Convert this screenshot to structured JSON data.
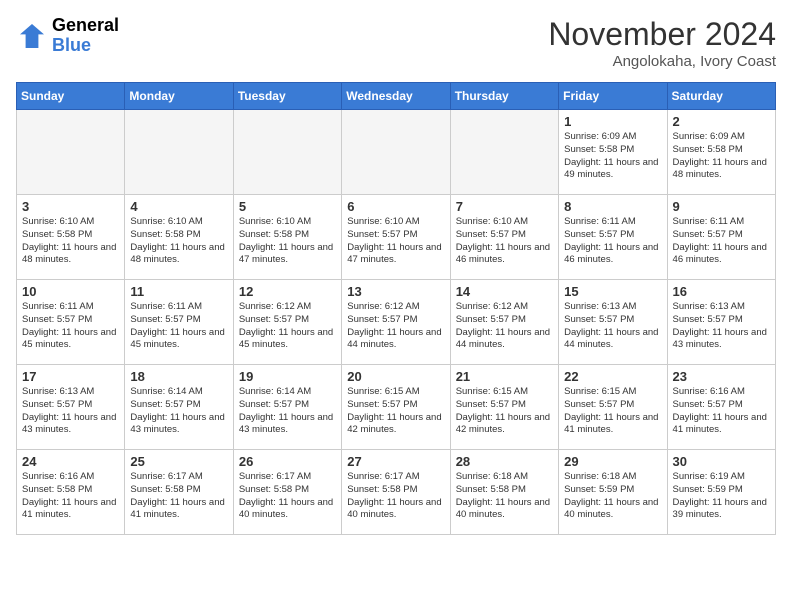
{
  "header": {
    "logo": {
      "general": "General",
      "blue": "Blue"
    },
    "month": "November 2024",
    "location": "Angolokaha, Ivory Coast"
  },
  "weekdays": [
    "Sunday",
    "Monday",
    "Tuesday",
    "Wednesday",
    "Thursday",
    "Friday",
    "Saturday"
  ],
  "weeks": [
    [
      {
        "day": "",
        "empty": true
      },
      {
        "day": "",
        "empty": true
      },
      {
        "day": "",
        "empty": true
      },
      {
        "day": "",
        "empty": true
      },
      {
        "day": "",
        "empty": true
      },
      {
        "day": "1",
        "sunrise": "Sunrise: 6:09 AM",
        "sunset": "Sunset: 5:58 PM",
        "daylight": "Daylight: 11 hours and 49 minutes."
      },
      {
        "day": "2",
        "sunrise": "Sunrise: 6:09 AM",
        "sunset": "Sunset: 5:58 PM",
        "daylight": "Daylight: 11 hours and 48 minutes."
      }
    ],
    [
      {
        "day": "3",
        "sunrise": "Sunrise: 6:10 AM",
        "sunset": "Sunset: 5:58 PM",
        "daylight": "Daylight: 11 hours and 48 minutes."
      },
      {
        "day": "4",
        "sunrise": "Sunrise: 6:10 AM",
        "sunset": "Sunset: 5:58 PM",
        "daylight": "Daylight: 11 hours and 48 minutes."
      },
      {
        "day": "5",
        "sunrise": "Sunrise: 6:10 AM",
        "sunset": "Sunset: 5:58 PM",
        "daylight": "Daylight: 11 hours and 47 minutes."
      },
      {
        "day": "6",
        "sunrise": "Sunrise: 6:10 AM",
        "sunset": "Sunset: 5:57 PM",
        "daylight": "Daylight: 11 hours and 47 minutes."
      },
      {
        "day": "7",
        "sunrise": "Sunrise: 6:10 AM",
        "sunset": "Sunset: 5:57 PM",
        "daylight": "Daylight: 11 hours and 46 minutes."
      },
      {
        "day": "8",
        "sunrise": "Sunrise: 6:11 AM",
        "sunset": "Sunset: 5:57 PM",
        "daylight": "Daylight: 11 hours and 46 minutes."
      },
      {
        "day": "9",
        "sunrise": "Sunrise: 6:11 AM",
        "sunset": "Sunset: 5:57 PM",
        "daylight": "Daylight: 11 hours and 46 minutes."
      }
    ],
    [
      {
        "day": "10",
        "sunrise": "Sunrise: 6:11 AM",
        "sunset": "Sunset: 5:57 PM",
        "daylight": "Daylight: 11 hours and 45 minutes."
      },
      {
        "day": "11",
        "sunrise": "Sunrise: 6:11 AM",
        "sunset": "Sunset: 5:57 PM",
        "daylight": "Daylight: 11 hours and 45 minutes."
      },
      {
        "day": "12",
        "sunrise": "Sunrise: 6:12 AM",
        "sunset": "Sunset: 5:57 PM",
        "daylight": "Daylight: 11 hours and 45 minutes."
      },
      {
        "day": "13",
        "sunrise": "Sunrise: 6:12 AM",
        "sunset": "Sunset: 5:57 PM",
        "daylight": "Daylight: 11 hours and 44 minutes."
      },
      {
        "day": "14",
        "sunrise": "Sunrise: 6:12 AM",
        "sunset": "Sunset: 5:57 PM",
        "daylight": "Daylight: 11 hours and 44 minutes."
      },
      {
        "day": "15",
        "sunrise": "Sunrise: 6:13 AM",
        "sunset": "Sunset: 5:57 PM",
        "daylight": "Daylight: 11 hours and 44 minutes."
      },
      {
        "day": "16",
        "sunrise": "Sunrise: 6:13 AM",
        "sunset": "Sunset: 5:57 PM",
        "daylight": "Daylight: 11 hours and 43 minutes."
      }
    ],
    [
      {
        "day": "17",
        "sunrise": "Sunrise: 6:13 AM",
        "sunset": "Sunset: 5:57 PM",
        "daylight": "Daylight: 11 hours and 43 minutes."
      },
      {
        "day": "18",
        "sunrise": "Sunrise: 6:14 AM",
        "sunset": "Sunset: 5:57 PM",
        "daylight": "Daylight: 11 hours and 43 minutes."
      },
      {
        "day": "19",
        "sunrise": "Sunrise: 6:14 AM",
        "sunset": "Sunset: 5:57 PM",
        "daylight": "Daylight: 11 hours and 43 minutes."
      },
      {
        "day": "20",
        "sunrise": "Sunrise: 6:15 AM",
        "sunset": "Sunset: 5:57 PM",
        "daylight": "Daylight: 11 hours and 42 minutes."
      },
      {
        "day": "21",
        "sunrise": "Sunrise: 6:15 AM",
        "sunset": "Sunset: 5:57 PM",
        "daylight": "Daylight: 11 hours and 42 minutes."
      },
      {
        "day": "22",
        "sunrise": "Sunrise: 6:15 AM",
        "sunset": "Sunset: 5:57 PM",
        "daylight": "Daylight: 11 hours and 41 minutes."
      },
      {
        "day": "23",
        "sunrise": "Sunrise: 6:16 AM",
        "sunset": "Sunset: 5:57 PM",
        "daylight": "Daylight: 11 hours and 41 minutes."
      }
    ],
    [
      {
        "day": "24",
        "sunrise": "Sunrise: 6:16 AM",
        "sunset": "Sunset: 5:58 PM",
        "daylight": "Daylight: 11 hours and 41 minutes."
      },
      {
        "day": "25",
        "sunrise": "Sunrise: 6:17 AM",
        "sunset": "Sunset: 5:58 PM",
        "daylight": "Daylight: 11 hours and 41 minutes."
      },
      {
        "day": "26",
        "sunrise": "Sunrise: 6:17 AM",
        "sunset": "Sunset: 5:58 PM",
        "daylight": "Daylight: 11 hours and 40 minutes."
      },
      {
        "day": "27",
        "sunrise": "Sunrise: 6:17 AM",
        "sunset": "Sunset: 5:58 PM",
        "daylight": "Daylight: 11 hours and 40 minutes."
      },
      {
        "day": "28",
        "sunrise": "Sunrise: 6:18 AM",
        "sunset": "Sunset: 5:58 PM",
        "daylight": "Daylight: 11 hours and 40 minutes."
      },
      {
        "day": "29",
        "sunrise": "Sunrise: 6:18 AM",
        "sunset": "Sunset: 5:59 PM",
        "daylight": "Daylight: 11 hours and 40 minutes."
      },
      {
        "day": "30",
        "sunrise": "Sunrise: 6:19 AM",
        "sunset": "Sunset: 5:59 PM",
        "daylight": "Daylight: 11 hours and 39 minutes."
      }
    ]
  ]
}
